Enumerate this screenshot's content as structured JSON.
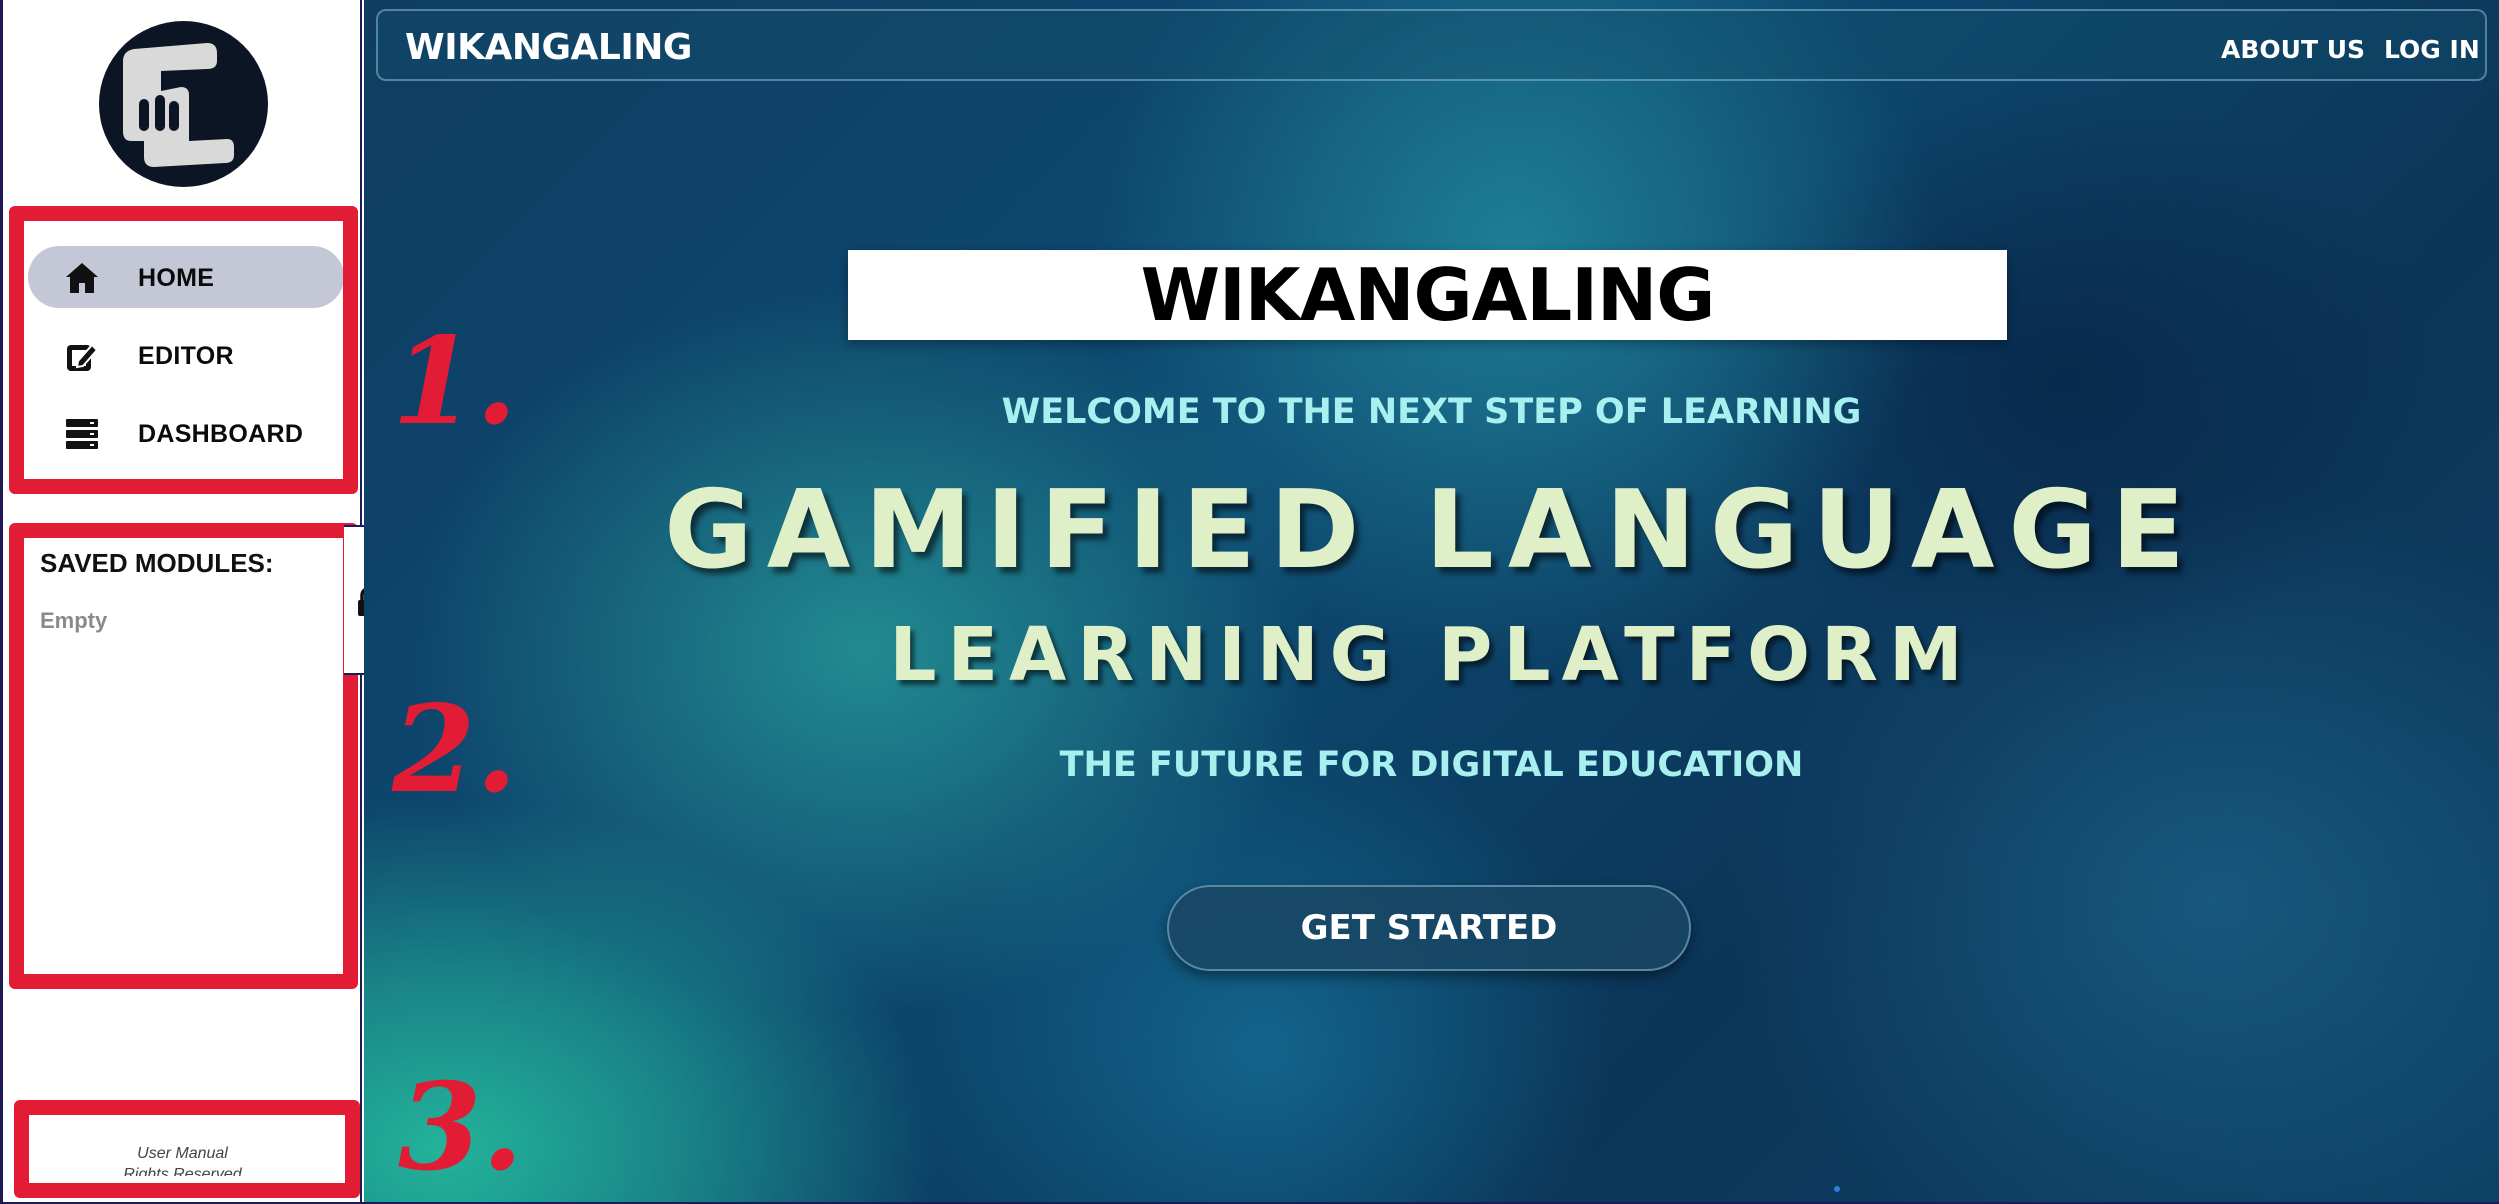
{
  "sidebar": {
    "nav": [
      {
        "label": "HOME",
        "icon": "home-icon",
        "active": true
      },
      {
        "label": "EDITOR",
        "icon": "edit-icon",
        "active": false
      },
      {
        "label": "DASHBOARD",
        "icon": "dashboard-icon",
        "active": false
      }
    ],
    "saved_title": "SAVED MODULES:",
    "saved_empty": "Empty",
    "footer_line1": "User Manual",
    "footer_line2": "Rights Reserved"
  },
  "annotations": {
    "n1": "1.",
    "n2": "2.",
    "n3": "3.",
    "color": "#e21c34"
  },
  "topbar": {
    "brand": "WIKANGALING",
    "about": "ABOUT US",
    "login": "LOG IN"
  },
  "hero": {
    "title": "WIKANGALING",
    "welcome": "WELCOME TO THE NEXT STEP OF LEARNING",
    "line1": "GAMIFIED LANGUAGE",
    "line2": "LEARNING PLATFORM",
    "tagline": "THE FUTURE FOR DIGITAL EDUCATION",
    "cta": "GET STARTED"
  },
  "colors": {
    "sidebar_border": "#1e1a55",
    "active_nav": "#c4c8d6",
    "hero_text": "#dff0c8",
    "accent_text": "#a8f0f0"
  }
}
